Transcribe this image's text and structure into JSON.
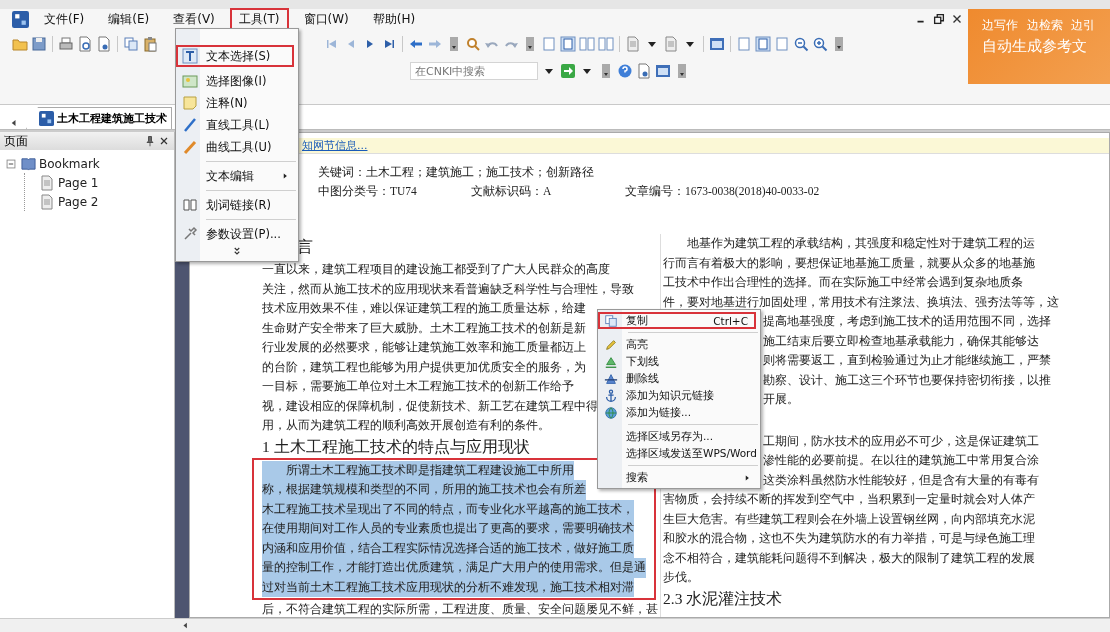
{
  "menubar": {
    "items": [
      {
        "label": "文件(F)",
        "selected": false
      },
      {
        "label": "编辑(E)",
        "selected": false
      },
      {
        "label": "查看(V)",
        "selected": false
      },
      {
        "label": "工具(T)",
        "selected": true
      },
      {
        "label": "窗口(W)",
        "selected": false
      },
      {
        "label": "帮助(H)",
        "selected": false
      }
    ]
  },
  "ad_banner": {
    "lines": [
      "边写作 边检索 边引",
      "自动生成参考文"
    ]
  },
  "search": {
    "placeholder": "在CNKI中搜索"
  },
  "tabs": [
    {
      "label": "土木工程建筑施工技术",
      "selected": true
    }
  ],
  "sidebar": {
    "title": "页面",
    "tree": [
      {
        "label": "Bookmark",
        "expanded": true,
        "children": [
          {
            "label": "Page 1"
          },
          {
            "label": "Page 2"
          }
        ]
      }
    ]
  },
  "tools_menu": {
    "items": [
      {
        "kind": "item",
        "label": "文本选择(S)",
        "selected": true
      },
      {
        "kind": "item",
        "label": "选择图像(I)",
        "selected": false
      },
      {
        "kind": "item",
        "label": "注释(N)",
        "selected": false
      },
      {
        "kind": "item",
        "label": "直线工具(L)",
        "selected": false
      },
      {
        "kind": "item",
        "label": "曲线工具(U)",
        "selected": false
      },
      {
        "kind": "separator"
      },
      {
        "kind": "submenu",
        "label": "文本编辑",
        "selected": false
      },
      {
        "kind": "separator"
      },
      {
        "kind": "item",
        "label": "划词链接(R)",
        "selected": false
      },
      {
        "kind": "separator"
      },
      {
        "kind": "item",
        "label": "参数设置(P)...",
        "selected": false
      },
      {
        "kind": "more"
      }
    ]
  },
  "context_menu": {
    "items": [
      {
        "kind": "item",
        "label": "复制",
        "shortcut": "Ctrl+C",
        "selected": true
      },
      {
        "kind": "separator"
      },
      {
        "kind": "item",
        "label": "高亮",
        "selected": false
      },
      {
        "kind": "item",
        "label": "下划线",
        "selected": false
      },
      {
        "kind": "item",
        "label": "删除线",
        "selected": false
      },
      {
        "kind": "item",
        "label": "添加为知识元链接",
        "selected": false
      },
      {
        "kind": "item",
        "label": "添加为链接...",
        "selected": false
      },
      {
        "kind": "separator"
      },
      {
        "kind": "item",
        "label": "选择区域另存为...",
        "selected": false
      },
      {
        "kind": "item",
        "label": "选择区域发送至WPS/Word",
        "selected": false
      },
      {
        "kind": "separator"
      },
      {
        "kind": "submenu",
        "label": "搜索",
        "selected": false
      }
    ]
  },
  "document": {
    "info_link": "知网节信息...",
    "keywords": "关键词：土木工程；建筑施工；施工技术；创新路径",
    "classification": "中图分类号：TU74",
    "doc_code": "文献标识码：A",
    "article_no": "文章编号：1673-0038(2018)40-0033-02",
    "left_column": [
      {
        "kind": "heading",
        "text": "言",
        "covered": true
      },
      {
        "kind": "para",
        "indent": false,
        "selected": false,
        "lines": [
          {
            "text": "一直以来，建筑工程项目的建设施工都受到了广大人民群众的高度"
          },
          {
            "text": "关注，然而从施工技术的应用现状来看普遍缺乏科学性与合理性，导致"
          },
          {
            "text": "技术应用效果不佳，难以保证建筑工程的施工质量达标，给建"
          },
          {
            "text": "生命财产安全带来了巨大威胁。土木工程施工技术的创新是新"
          },
          {
            "text": "行业发展的必然要求，能够让建筑施工效率和施工质量都迈上"
          },
          {
            "text": "的台阶，建筑工程也能够为用户提供更加优质安全的服务，为"
          },
          {
            "text": "一目标，需要施工单位对土木工程施工技术的创新工作给予"
          },
          {
            "text": "视，建设相应的保障机制，促使新技术、新工艺在建筑工程中得"
          },
          {
            "text": "用，从而为建筑工程的顺利高效开展创造有利的条件。"
          }
        ]
      },
      {
        "kind": "heading",
        "text": "1  土木工程施工技术的特点与应用现状"
      },
      {
        "kind": "para",
        "indent": true,
        "selected": true,
        "lines": [
          {
            "text": "所谓土木工程施工技术即是指建筑工程建设施工中所用"
          },
          {
            "text": "称，根据建筑规模和类型的不同，所用的施工技术也会有所差"
          },
          {
            "text": "木工程施工技术呈现出了不同的特点，而专业化水平越高的施工技术，"
          },
          {
            "text": "在使用期间对工作人员的专业素质也提出了更高的要求，需要明确技术"
          },
          {
            "text": "内涵和应用价值，结合工程实际情况选择合适的施工技术，做好施工质"
          },
          {
            "text": "量的控制工作，才能打造出优质建筑，满足广大用户的使用需求。但是通"
          },
          {
            "text": "过对当前土木工程施工技术应用现状的分析不难发现，施工技术相对滞"
          }
        ]
      },
      {
        "kind": "para",
        "indent": false,
        "selected": false,
        "lines": [
          {
            "text": "后，不符合建筑工程的实际所需，工程进度、质量、安全问题屡见不鲜，甚"
          }
        ]
      }
    ],
    "right_column": [
      {
        "kind": "para",
        "indent": true,
        "selected": false,
        "lines": [
          {
            "text": "地基作为建筑工程的承载结构，其强度和稳定性对于建筑工程的运"
          },
          {
            "text": "行而言有着极大的影响，要想保证地基施工质量，就要从众多的地基施"
          },
          {
            "text": "工技术中作出合理性的选择。而在实际施工中经常会遇到复杂地质条"
          },
          {
            "text": "件，要对地基进行加固处理，常用技术有注浆法、换填法、强夯法等等，这"
          },
          {
            "text": "提高地基强度，考虑到施工技术的适用范围不同，选择",
            "covered": true
          },
          {
            "text": "施工结束后要立即检查地基承载能力，确保其能够达",
            "covered": true
          },
          {
            "text": "则将需要返工，直到检验通过为止才能继续施工，严禁",
            "covered": true
          },
          {
            "text": "勘察、设计、施工这三个环节也要保持密切衔接，以推",
            "covered": true
          },
          {
            "text": "开展。",
            "covered": true
          }
        ]
      },
      {
        "kind": "para",
        "indent": false,
        "selected": false,
        "lines": [
          {
            "text": "工期间，防水技术的应用必不可少，这是保证建筑工",
            "covered": true
          },
          {
            "text": "渗性能的必要前提。在以往的建筑施工中常用复合涂",
            "covered": true
          },
          {
            "text": "这类涂料虽然防水性能较好，但是含有大量的有毒有",
            "covered": true
          },
          {
            "text": "害物质，会持续不断的挥发到空气中，当积累到一定量时就会对人体产"
          },
          {
            "text": "生巨大危害。有些建筑工程则会在外墙上设置钢丝网，向内部填充水泥"
          },
          {
            "text": "和胶水的混合物，这也不失为建筑防水的有力举措，可是与绿色施工理"
          },
          {
            "text": "念不相符合，建筑能耗问题得不到解决，极大的限制了建筑工程的发展"
          },
          {
            "text": "步伐。"
          }
        ]
      },
      {
        "kind": "heading",
        "text": "2.3  水泥灌注技术"
      }
    ]
  }
}
